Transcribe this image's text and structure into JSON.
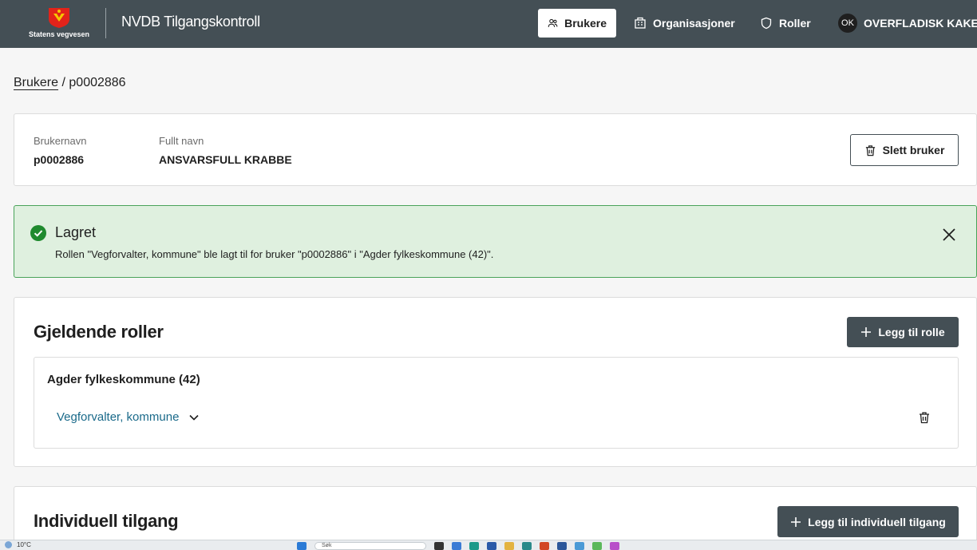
{
  "header": {
    "logo_text": "Statens vegvesen",
    "app_title": "NVDB Tilgangskontroll",
    "nav": [
      {
        "label": "Brukere",
        "icon": "users-icon",
        "active": true
      },
      {
        "label": "Organisasjoner",
        "icon": "building-icon",
        "active": false
      },
      {
        "label": "Roller",
        "icon": "shield-icon",
        "active": false
      }
    ],
    "user": {
      "initials": "OK",
      "name": "OVERFLADISK KAKE"
    }
  },
  "breadcrumb": {
    "root": "Brukere",
    "separator": "/",
    "current": "p0002886"
  },
  "user_details": {
    "username_label": "Brukernavn",
    "username": "p0002886",
    "fullname_label": "Fullt navn",
    "fullname": "ANSVARSFULL KRABBE",
    "delete_label": "Slett bruker"
  },
  "alert": {
    "title": "Lagret",
    "message": "Rollen \"Vegforvalter, kommune\" ble lagt til for bruker \"p0002886\" i \"Agder fylkeskommune (42)\".",
    "status_color": "#4aa35a"
  },
  "roles": {
    "title": "Gjeldende roller",
    "add_label": "Legg til rolle",
    "orgs": [
      {
        "name": "Agder fylkeskommune (42)",
        "roles": [
          {
            "label": "Vegforvalter, kommune"
          }
        ]
      }
    ]
  },
  "access": {
    "title": "Individuell tilgang",
    "add_label": "Legg til individuell tilgang"
  },
  "taskbar": {
    "temperature": "10°C",
    "search_placeholder": "Søk"
  },
  "colors": {
    "header_bg": "#444f55",
    "link": "#1a6a8a",
    "alert_bg": "#dff0df"
  }
}
